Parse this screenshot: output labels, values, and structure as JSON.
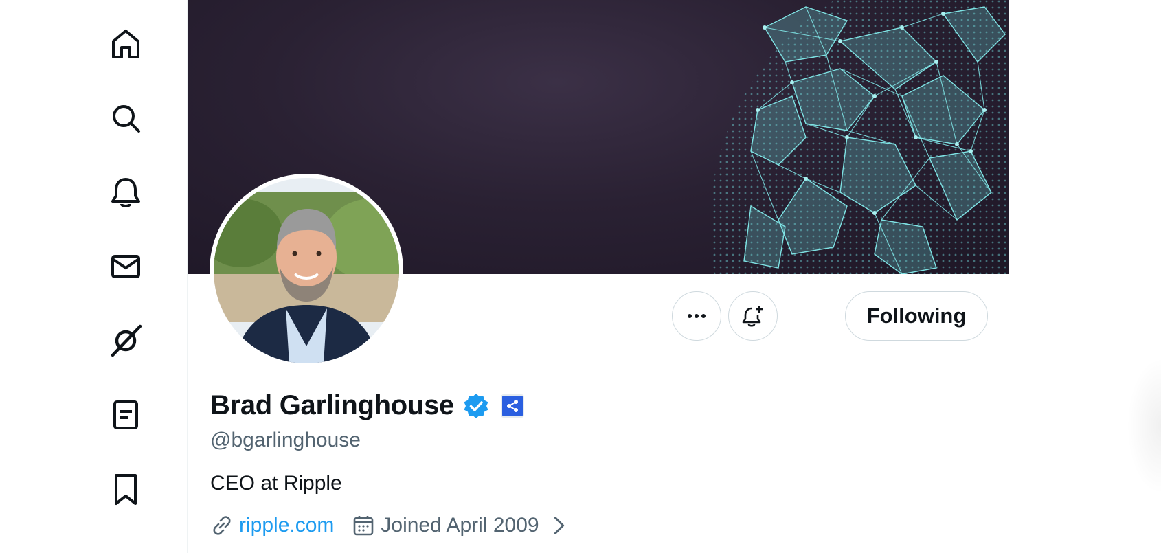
{
  "nav": {
    "items": [
      {
        "name": "home",
        "icon": "home-icon"
      },
      {
        "name": "explore",
        "icon": "search-icon"
      },
      {
        "name": "notifications",
        "icon": "bell-icon"
      },
      {
        "name": "messages",
        "icon": "envelope-icon"
      },
      {
        "name": "grok",
        "icon": "grok-icon"
      },
      {
        "name": "lists",
        "icon": "list-icon"
      },
      {
        "name": "bookmarks",
        "icon": "bookmark-icon"
      }
    ]
  },
  "profile": {
    "name": "Brad Garlinghouse",
    "handle": "@bgarlinghouse",
    "bio": "CEO at Ripple",
    "website": "ripple.com",
    "joined": "Joined April 2009",
    "verified": true,
    "affiliation_badge": "ripple-logo-icon"
  },
  "actions": {
    "more_icon": "more-icon",
    "notify_icon": "bell-plus-icon",
    "following_label": "Following"
  },
  "colors": {
    "accent": "#1d9bf0",
    "text_primary": "#0f1419",
    "text_secondary": "#536471",
    "banner_bg": "#2a2133",
    "network": "#6fd6d8",
    "affiliation_bg": "#2a5fe0"
  }
}
